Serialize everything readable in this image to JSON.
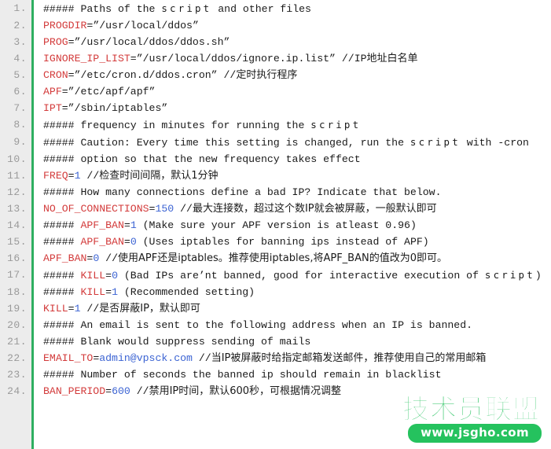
{
  "editor": {
    "language": "shell",
    "gutter_bg": "#ececec",
    "gutter_rule_color": "#2eae61",
    "variable_color": "#d33b3b",
    "number_color": "#3b63d3",
    "text_color": "#1a1a1a",
    "line_number_color": "#9a9a9a",
    "line_number_suffix": "."
  },
  "lines": [
    {
      "n": "1.",
      "tokens": [
        {
          "t": "plain",
          "v": "##### Paths of the "
        },
        {
          "t": "script",
          "v": "script"
        },
        {
          "t": "plain",
          "v": " and other files"
        }
      ]
    },
    {
      "n": "2.",
      "tokens": [
        {
          "t": "var",
          "v": "PROGDIR"
        },
        {
          "t": "plain",
          "v": "=”/usr/local/ddos”"
        }
      ]
    },
    {
      "n": "3.",
      "tokens": [
        {
          "t": "var",
          "v": "PROG"
        },
        {
          "t": "plain",
          "v": "=”/usr/local/ddos/ddos.sh”"
        }
      ]
    },
    {
      "n": "4.",
      "tokens": [
        {
          "t": "var",
          "v": "IGNORE_IP_LIST"
        },
        {
          "t": "plain",
          "v": "=”/usr/local/ddos/ignore.ip.list” //IP"
        },
        {
          "t": "cn",
          "v": "地址白名单"
        }
      ]
    },
    {
      "n": "5.",
      "tokens": [
        {
          "t": "var",
          "v": "CRON"
        },
        {
          "t": "plain",
          "v": "=”/etc/cron.d/ddos.cron” //"
        },
        {
          "t": "cn",
          "v": "定时执行程序"
        }
      ]
    },
    {
      "n": "6.",
      "tokens": [
        {
          "t": "var",
          "v": "APF"
        },
        {
          "t": "plain",
          "v": "=”/etc/apf/apf”"
        }
      ]
    },
    {
      "n": "7.",
      "tokens": [
        {
          "t": "var",
          "v": "IPT"
        },
        {
          "t": "plain",
          "v": "=”/sbin/iptables”"
        }
      ]
    },
    {
      "n": "8.",
      "tokens": [
        {
          "t": "plain",
          "v": "##### frequency in minutes for running the "
        },
        {
          "t": "script",
          "v": "script"
        }
      ]
    },
    {
      "n": "9.",
      "tokens": [
        {
          "t": "plain",
          "v": "##### Caution: Every time this setting is changed, run the "
        },
        {
          "t": "script",
          "v": "script"
        },
        {
          "t": "plain",
          "v": " with -cron"
        }
      ]
    },
    {
      "n": "10.",
      "tokens": [
        {
          "t": "plain",
          "v": "##### option so that the new frequency takes effect"
        }
      ]
    },
    {
      "n": "11.",
      "tokens": [
        {
          "t": "var",
          "v": "FREQ"
        },
        {
          "t": "plain",
          "v": "="
        },
        {
          "t": "num",
          "v": "1"
        },
        {
          "t": "plain",
          "v": " //"
        },
        {
          "t": "cn",
          "v": "检查时间间隔，默认1分钟"
        }
      ]
    },
    {
      "n": "12.",
      "tokens": [
        {
          "t": "plain",
          "v": "##### How many connections define a bad IP? Indicate that below."
        }
      ]
    },
    {
      "n": "13.",
      "tokens": [
        {
          "t": "var",
          "v": "NO_OF_CONNECTIONS"
        },
        {
          "t": "plain",
          "v": "="
        },
        {
          "t": "num",
          "v": "150"
        },
        {
          "t": "plain",
          "v": " //"
        },
        {
          "t": "cn",
          "v": "最大连接数，超过这个数IP就会被屏蔽，一般默认即可"
        }
      ]
    },
    {
      "n": "14.",
      "tokens": [
        {
          "t": "plain",
          "v": "##### "
        },
        {
          "t": "var",
          "v": "APF_BAN"
        },
        {
          "t": "plain",
          "v": "="
        },
        {
          "t": "num",
          "v": "1"
        },
        {
          "t": "plain",
          "v": " (Make sure your APF version is atleast 0.96)"
        }
      ]
    },
    {
      "n": "15.",
      "tokens": [
        {
          "t": "plain",
          "v": "##### "
        },
        {
          "t": "var",
          "v": "APF_BAN"
        },
        {
          "t": "plain",
          "v": "="
        },
        {
          "t": "num",
          "v": "0"
        },
        {
          "t": "plain",
          "v": " (Uses iptables for banning ips instead of APF)"
        }
      ]
    },
    {
      "n": "16.",
      "tokens": [
        {
          "t": "var",
          "v": "APF_BAN"
        },
        {
          "t": "plain",
          "v": "="
        },
        {
          "t": "num",
          "v": "0"
        },
        {
          "t": "plain",
          "v": " //"
        },
        {
          "t": "cn",
          "v": "使用APF还是iptables。推荐使用iptables,将APF_BAN的值改为0即可。"
        }
      ]
    },
    {
      "n": "17.",
      "tokens": [
        {
          "t": "plain",
          "v": "##### "
        },
        {
          "t": "var",
          "v": "KILL"
        },
        {
          "t": "plain",
          "v": "="
        },
        {
          "t": "num",
          "v": "0"
        },
        {
          "t": "plain",
          "v": " (Bad IPs are’nt banned, good for interactive execution of "
        },
        {
          "t": "script",
          "v": "script"
        },
        {
          "t": "plain",
          "v": ")"
        }
      ]
    },
    {
      "n": "18.",
      "tokens": [
        {
          "t": "plain",
          "v": "##### "
        },
        {
          "t": "var",
          "v": "KILL"
        },
        {
          "t": "plain",
          "v": "="
        },
        {
          "t": "num",
          "v": "1"
        },
        {
          "t": "plain",
          "v": " (Recommended setting)"
        }
      ]
    },
    {
      "n": "19.",
      "tokens": [
        {
          "t": "var",
          "v": "KILL"
        },
        {
          "t": "plain",
          "v": "="
        },
        {
          "t": "num",
          "v": "1"
        },
        {
          "t": "plain",
          "v": " //"
        },
        {
          "t": "cn",
          "v": "是否屏蔽IP，默认即可"
        }
      ]
    },
    {
      "n": "20.",
      "tokens": [
        {
          "t": "plain",
          "v": "##### An email is sent to the following address when an IP is banned."
        }
      ]
    },
    {
      "n": "21.",
      "tokens": [
        {
          "t": "plain",
          "v": "##### Blank would suppress sending of mails"
        }
      ]
    },
    {
      "n": "22.",
      "tokens": [
        {
          "t": "var",
          "v": "EMAIL_TO"
        },
        {
          "t": "plain",
          "v": "="
        },
        {
          "t": "num",
          "v": "admin@vpsck.com"
        },
        {
          "t": "plain",
          "v": " //"
        },
        {
          "t": "cn",
          "v": "当IP被屏蔽时给指定邮箱发送邮件，推荐使用自己的常用邮箱"
        }
      ]
    },
    {
      "n": "23.",
      "tokens": [
        {
          "t": "plain",
          "v": "##### Number of seconds the banned ip should remain in blacklist"
        }
      ]
    },
    {
      "n": "24.",
      "tokens": [
        {
          "t": "var",
          "v": "BAN_PERIOD"
        },
        {
          "t": "plain",
          "v": "="
        },
        {
          "t": "num",
          "v": "600"
        },
        {
          "t": "plain",
          "v": " //"
        },
        {
          "t": "cn",
          "v": "禁用IP时间，默认600秒，可根据情况调整"
        }
      ]
    }
  ],
  "watermark": {
    "brand_cn": "技术员联盟",
    "url": "www.jsgho.com",
    "color": "#25c25e"
  }
}
